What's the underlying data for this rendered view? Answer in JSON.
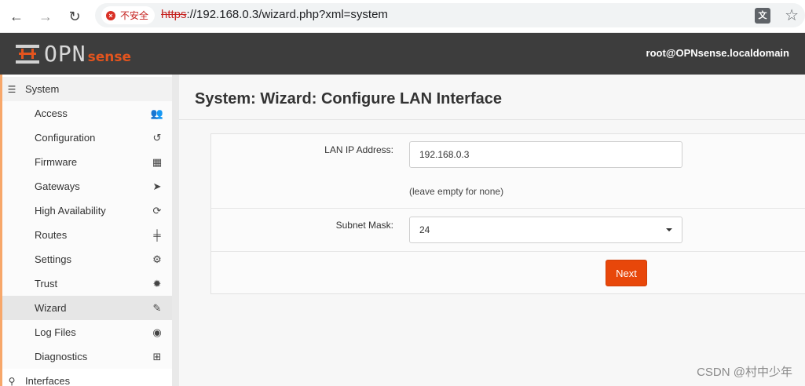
{
  "browser": {
    "security_label": "不安全",
    "url_scheme": "https",
    "url_rest": "://192.168.0.3/wizard.php?xml=system",
    "translate_icon_glyph": "文"
  },
  "header": {
    "logo_text_opn": "OPN",
    "logo_text_sense": "sense",
    "user": "root@OPNsense.localdomain"
  },
  "sidebar": {
    "section": {
      "label": "System",
      "icon": "server-icon"
    },
    "items": [
      {
        "label": "Access",
        "icon": "users-icon",
        "glyph": "👥"
      },
      {
        "label": "Configuration",
        "icon": "history-icon",
        "glyph": "↺"
      },
      {
        "label": "Firmware",
        "icon": "building-icon",
        "glyph": "▦"
      },
      {
        "label": "Gateways",
        "icon": "location-arrow-icon",
        "glyph": "➤"
      },
      {
        "label": "High Availability",
        "icon": "refresh-icon",
        "glyph": "⟳"
      },
      {
        "label": "Routes",
        "icon": "signpost-icon",
        "glyph": "╪"
      },
      {
        "label": "Settings",
        "icon": "cogs-icon",
        "glyph": "⚙"
      },
      {
        "label": "Trust",
        "icon": "certificate-icon",
        "glyph": "✹"
      },
      {
        "label": "Wizard",
        "icon": "magic-wand-icon",
        "glyph": "✎"
      },
      {
        "label": "Log Files",
        "icon": "eye-icon",
        "glyph": "◉"
      },
      {
        "label": "Diagnostics",
        "icon": "medkit-icon",
        "glyph": "⊞"
      }
    ],
    "next_section": {
      "label": "Interfaces",
      "icon": "sitemap-icon",
      "glyph": "⚲"
    }
  },
  "page": {
    "title": "System: Wizard: Configure LAN Interface"
  },
  "form": {
    "lan_ip_label": "LAN IP Address:",
    "lan_ip_value": "192.168.0.3",
    "lan_ip_hint": "(leave empty for none)",
    "subnet_label": "Subnet Mask:",
    "subnet_value": "24",
    "next_label": "Next"
  },
  "watermark": "CSDN @村中少年",
  "colors": {
    "accent": "#e3541e",
    "button": "#e8470a",
    "header_bg": "#3d3d3d"
  }
}
